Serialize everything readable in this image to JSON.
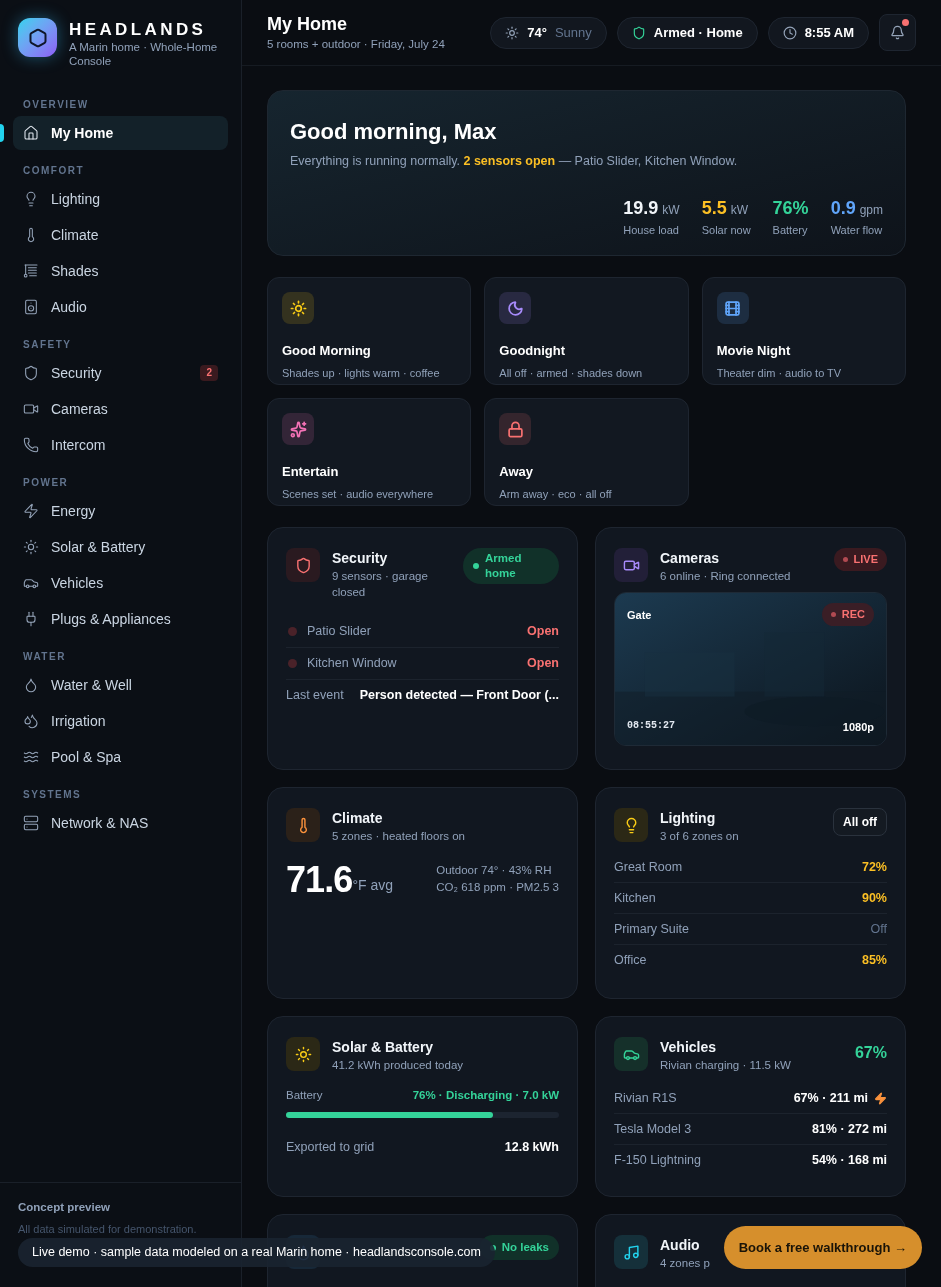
{
  "brand": {
    "name": "HEADLANDS",
    "tagline": "A Marin home · Whole-Home Console"
  },
  "sidebar": {
    "sections": [
      {
        "title": "OVERVIEW",
        "items": [
          {
            "label": "My Home",
            "selected": true
          }
        ]
      },
      {
        "title": "COMFORT",
        "items": [
          {
            "label": "Lighting",
            "selected": false
          },
          {
            "label": "Climate",
            "selected": false
          },
          {
            "label": "Shades",
            "selected": false
          },
          {
            "label": "Audio",
            "selected": false
          }
        ]
      },
      {
        "title": "SAFETY",
        "items": [
          {
            "label": "Security",
            "selected": false,
            "badge": "2"
          },
          {
            "label": "Cameras",
            "selected": false
          },
          {
            "label": "Intercom",
            "selected": false
          }
        ]
      },
      {
        "title": "POWER",
        "items": [
          {
            "label": "Energy",
            "selected": false
          },
          {
            "label": "Solar & Battery",
            "selected": false
          },
          {
            "label": "Vehicles",
            "selected": false
          },
          {
            "label": "Plugs & Appliances",
            "selected": false
          }
        ]
      },
      {
        "title": "WATER",
        "items": [
          {
            "label": "Water & Well",
            "selected": false
          },
          {
            "label": "Irrigation",
            "selected": false
          },
          {
            "label": "Pool & Spa",
            "selected": false
          }
        ]
      },
      {
        "title": "SYSTEMS",
        "items": [
          {
            "label": "Network & NAS",
            "selected": false
          }
        ]
      }
    ],
    "footer": {
      "title": "Concept preview",
      "text": "All data simulated for demonstration."
    }
  },
  "header": {
    "title": "My Home",
    "subtitle": "5 rooms + outdoor · Friday, July 24",
    "weather_temp": "74°",
    "weather_text": "Sunny",
    "security": "Armed · Home",
    "time": "8:55 AM",
    "notifications_unread": true
  },
  "hero": {
    "greeting": "Good morning, Max",
    "message": "Everything is running normally. **2 sensors open** — Patio Slider, Kitchen Window.",
    "stats": [
      {
        "value": "19.9",
        "unit": "kW",
        "label": "House load",
        "color": "#f1f5f9"
      },
      {
        "value": "5.5",
        "unit": "kW",
        "label": "Solar now",
        "color": "#fbbf24"
      },
      {
        "value": "76%",
        "label": "Battery",
        "color": "#34d399"
      },
      {
        "value": "0.9",
        "unit": "gpm",
        "label": "Water flow",
        "color": "#60a5fa"
      }
    ]
  },
  "scenes": [
    {
      "title": "Good Morning",
      "subtitle": "Shades up · lights warm · coffee",
      "color": "#facc15"
    },
    {
      "title": "Goodnight",
      "subtitle": "All off · armed · shades down",
      "color": "#a78bfa"
    },
    {
      "title": "Movie Night",
      "subtitle": "Theater dim · audio to TV",
      "color": "#60a5fa"
    },
    {
      "title": "Entertain",
      "subtitle": "Scenes set · audio everywhere",
      "color": "#f472b6"
    },
    {
      "title": "Away",
      "subtitle": "Arm away · eco · all off",
      "color": "#f87171"
    }
  ],
  "security": {
    "title": "Security",
    "subtitle": "9 sensors · garage closed",
    "status": "Armed home",
    "sensors": [
      {
        "name": "Patio Slider",
        "state": "Open"
      },
      {
        "name": "Kitchen Window",
        "state": "Open"
      }
    ],
    "last_event_label": "Last event",
    "last_event": "Person detected — Front Door (..."
  },
  "cameras": {
    "title": "Cameras",
    "subtitle": "6 online · Ring connected",
    "live": "LIVE",
    "feed": {
      "name": "Gate",
      "rec": "REC",
      "timestamp": "08:55:27",
      "resolution": "1080p"
    }
  },
  "climate": {
    "title": "Climate",
    "subtitle": "5 zones · heated floors on",
    "temperature": "71.6",
    "unit": "°F avg",
    "outdoor": "Outdoor 74° · 43% RH",
    "air": "CO₂ 618 ppm · PM2.5 3"
  },
  "lighting": {
    "title": "Lighting",
    "subtitle": "3 of 6 zones on",
    "button": "All off",
    "zones": [
      {
        "name": "Great Room",
        "value": "72%",
        "on": true
      },
      {
        "name": "Kitchen",
        "value": "90%",
        "on": true
      },
      {
        "name": "Primary Suite",
        "value": "Off",
        "on": false
      },
      {
        "name": "Office",
        "value": "85%",
        "on": true
      }
    ]
  },
  "solar": {
    "title": "Solar & Battery",
    "subtitle": "41.2 kWh produced today",
    "battery_label": "Battery",
    "battery_status": "76% · Discharging · 7.0 kW",
    "level": 0.76,
    "export_label": "Exported to grid",
    "export_value": "12.8 kWh"
  },
  "vehicles": {
    "title": "Vehicles",
    "subtitle": "Rivian charging · 11.5 kW",
    "percent": "67%",
    "list": [
      {
        "name": "Rivian R1S",
        "value": "67% · 211 mi",
        "charging": true
      },
      {
        "name": "Tesla Model 3",
        "value": "81% · 272 mi",
        "charging": false
      },
      {
        "name": "F-150 Lightning",
        "value": "54% · 168 mi",
        "charging": false
      }
    ]
  },
  "water": {
    "status": "No leaks"
  },
  "audio": {
    "title": "Audio",
    "subtitle": "4 zones p"
  },
  "toast": "Live demo · sample data modeled on a real Marin home · headlandsconsole.com",
  "cta": "Book a free walkthrough →"
}
